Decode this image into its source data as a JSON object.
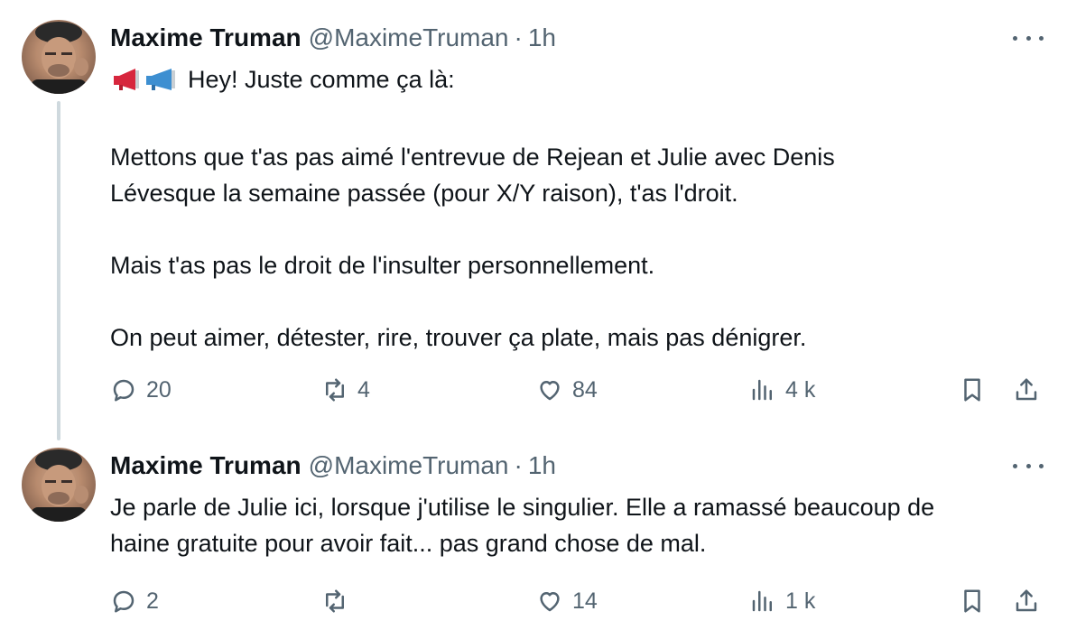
{
  "tweets": [
    {
      "name": "Maxime Truman",
      "handle": "@MaximeTruman",
      "separator": "·",
      "time": "1h",
      "intro_text": "Hey! Juste comme ça là:",
      "paragraphs": [
        "Mettons que t'as pas aimé l'entrevue de Rejean et Julie avec Denis\nLévesque la semaine passée (pour X/Y raison), t'as l'droit.",
        "Mais t'as pas le droit de l'insulter personnellement.",
        "On peut aimer, détester, rire, trouver ça plate, mais pas dénigrer."
      ],
      "replies": "20",
      "retweets": "4",
      "likes": "84",
      "views": "4 k"
    },
    {
      "name": "Maxime Truman",
      "handle": "@MaximeTruman",
      "separator": "·",
      "time": "1h",
      "text": "Je parle de Julie ici, lorsque j'utilise le singulier. Elle a ramassé beaucoup de\nhaine gratuite pour avoir fait... pas grand chose de mal.",
      "replies": "2",
      "retweets": "",
      "likes": "14",
      "views": "1 k"
    }
  ],
  "icons": {
    "reply": "speech-bubble-icon",
    "retweet": "retweet-arrows-icon",
    "like": "heart-icon",
    "views": "bar-chart-icon",
    "bookmark": "bookmark-icon",
    "share": "share-upload-icon",
    "more": "more-dots-icon",
    "emoji": "megaphone-icon"
  },
  "colors": {
    "text": "#0f1419",
    "secondary": "#536471",
    "thread_line": "#cfd9de",
    "megaphone_red": "#d7263d",
    "megaphone_blue": "#3d8fd1"
  }
}
